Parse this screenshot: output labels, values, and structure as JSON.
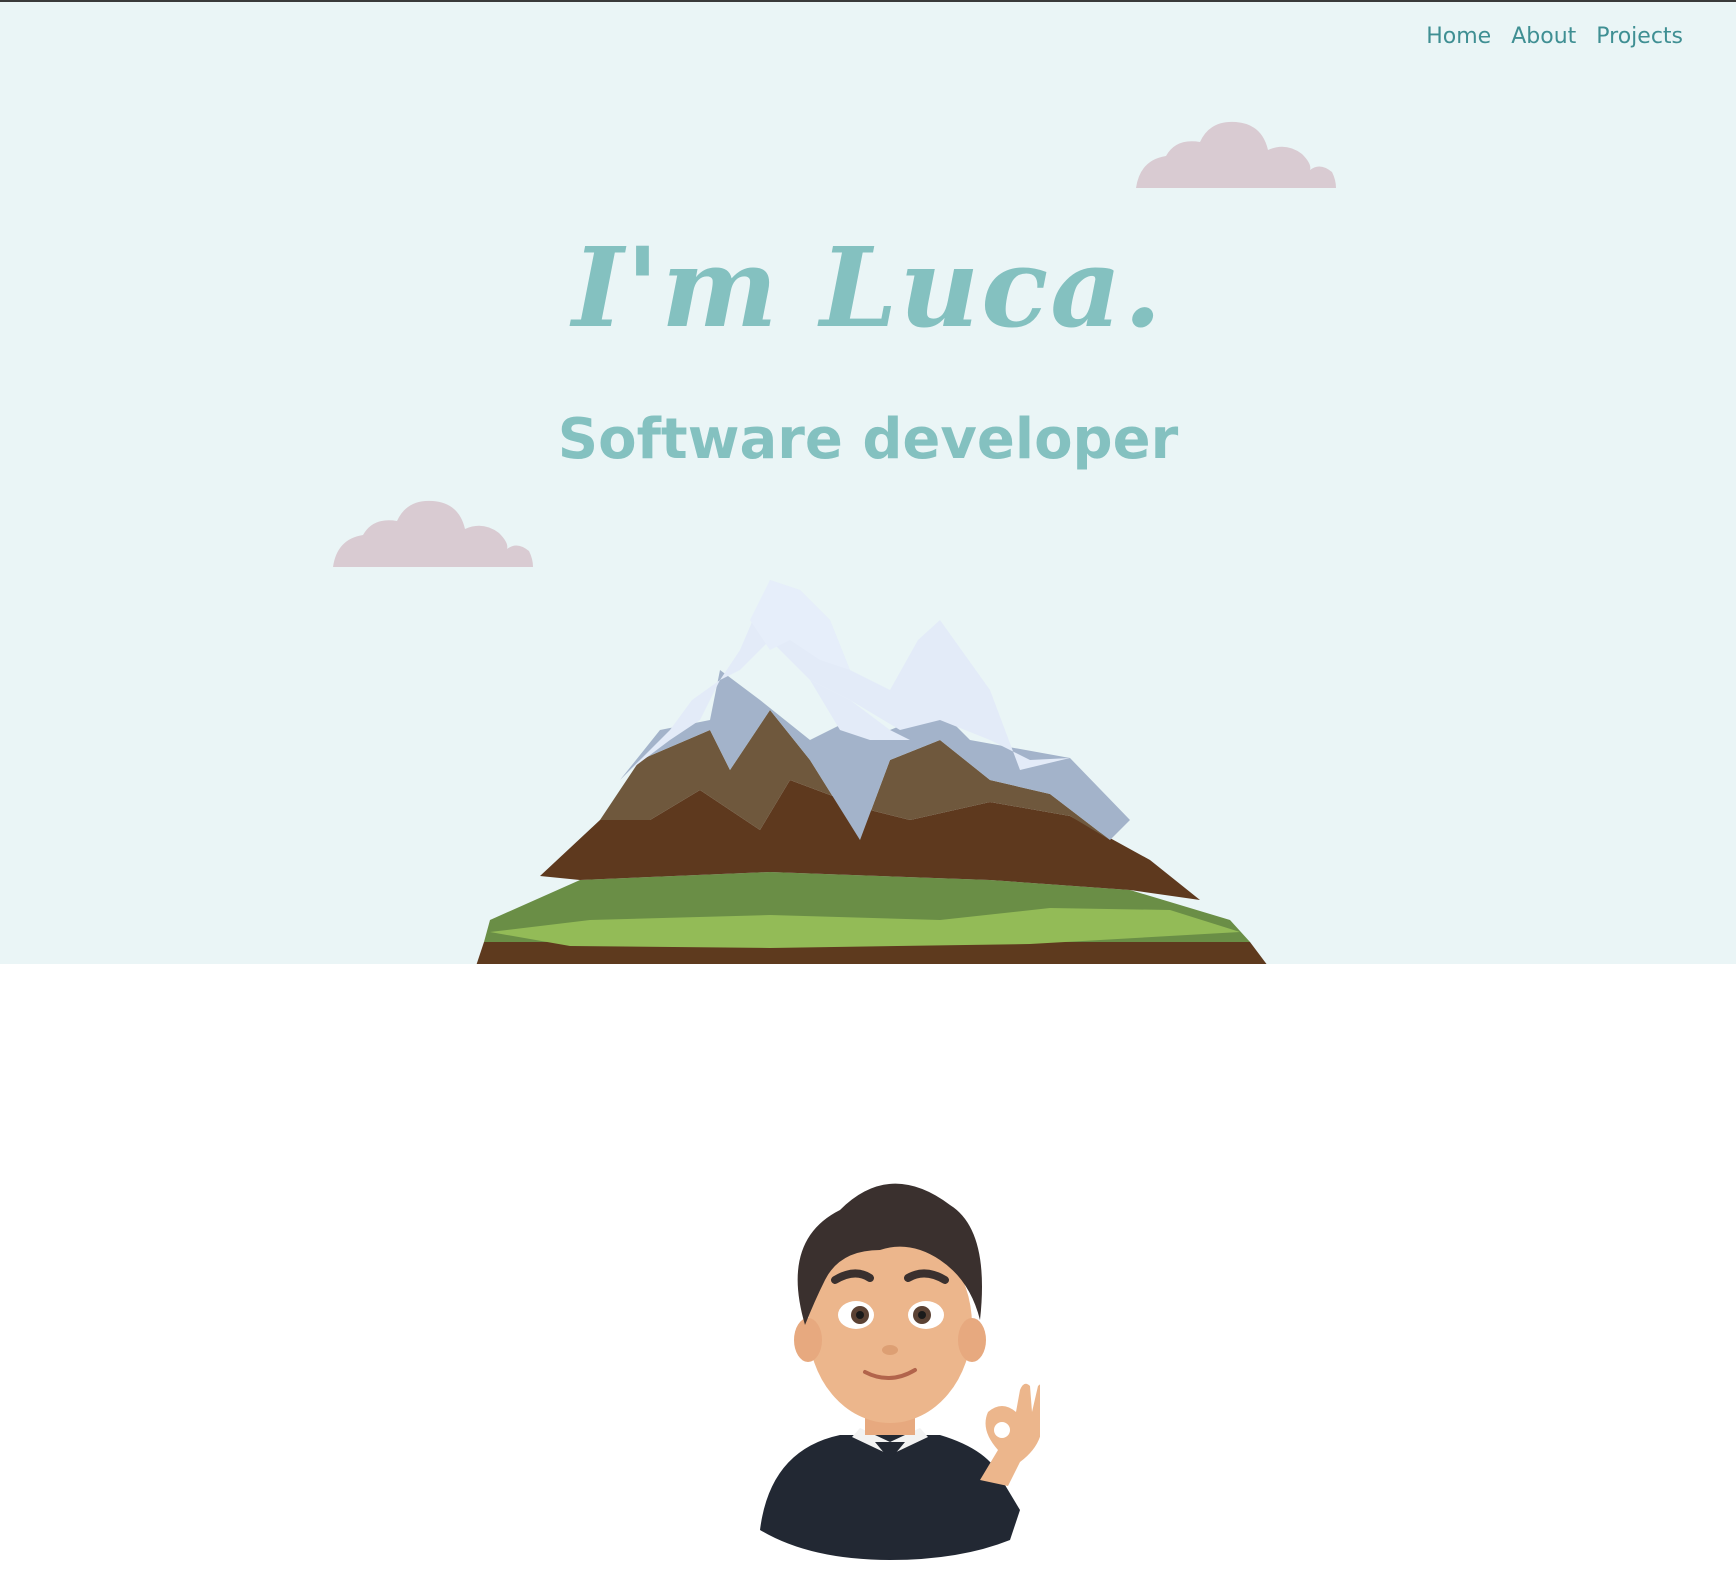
{
  "nav": {
    "items": [
      {
        "label": "Home"
      },
      {
        "label": "About"
      },
      {
        "label": "Projects"
      }
    ]
  },
  "hero": {
    "title": "I'm Luca.",
    "subtitle": "Software developer"
  },
  "colors": {
    "hero_background": "#eaf5f6",
    "accent": "#84c1c0",
    "nav_text": "#3f8f93",
    "cloud": "#d9cbd2",
    "page_background": "#ffffff"
  },
  "icons": {
    "cloud": "cloud-icon",
    "mountain": "mountain-illustration",
    "avatar": "avatar-illustration"
  }
}
